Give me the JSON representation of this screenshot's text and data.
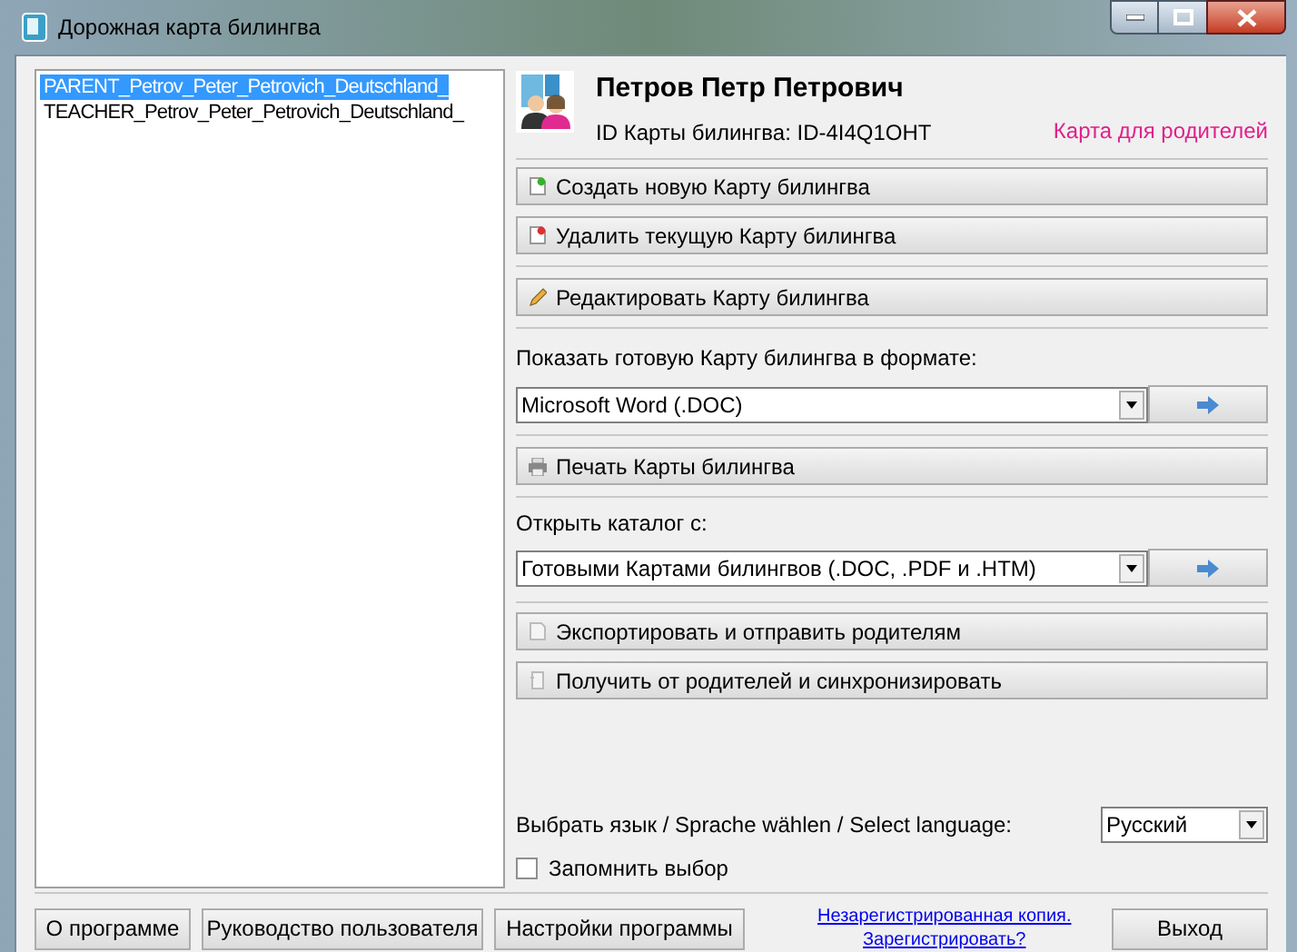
{
  "window": {
    "title": "Дорожная карта билингва"
  },
  "card_list": {
    "items": [
      {
        "label": "PARENT_Petrov_Peter_Petrovich_Deutschland_",
        "selected": true
      },
      {
        "label": "TEACHER_Petrov_Peter_Petrovich_Deutschland_",
        "selected": false
      }
    ]
  },
  "profile": {
    "name": "Петров Петр Петрович",
    "card_id": "ID Карты билингва: ID-4I4Q1OHT",
    "card_type": "Карта для родителей"
  },
  "card_buttons": [
    {
      "label": "Создать новую Карту билингва",
      "kind": "new"
    },
    {
      "label": "Удалить текущую Карту билингва",
      "kind": "delete"
    }
  ],
  "edit_button": {
    "label": "Редактировать Карту билингва",
    "kind": "edit"
  },
  "show_format": {
    "label": "Показать готовую Карту билингва в формате:",
    "value": "Microsoft Word (.DOC)"
  },
  "print_button": {
    "label": "Печать Карты билингва",
    "kind": "print"
  },
  "open_catalog": {
    "label": "Открыть каталог с:",
    "value": "Готовыми Картами билингвов (.DOC, .PDF и .HTM)"
  },
  "sync_buttons": [
    {
      "label": "Экспортировать и отправить родителям",
      "kind": "export"
    },
    {
      "label": "Получить от родителей и синхронизировать",
      "kind": "import"
    }
  ],
  "language": {
    "label": "Выбрать язык / Sprache wählen / Select language:",
    "value": "Русский"
  },
  "remember_choice": {
    "label": "Запомнить выбор",
    "checked": false
  },
  "footer": {
    "buttons": [
      "О программе",
      "Руководство пользователя",
      "Настройки программы"
    ],
    "link_lines": [
      "Незарегистрированная копия.",
      "Зарегистрировать?"
    ],
    "exit": "Выход"
  }
}
